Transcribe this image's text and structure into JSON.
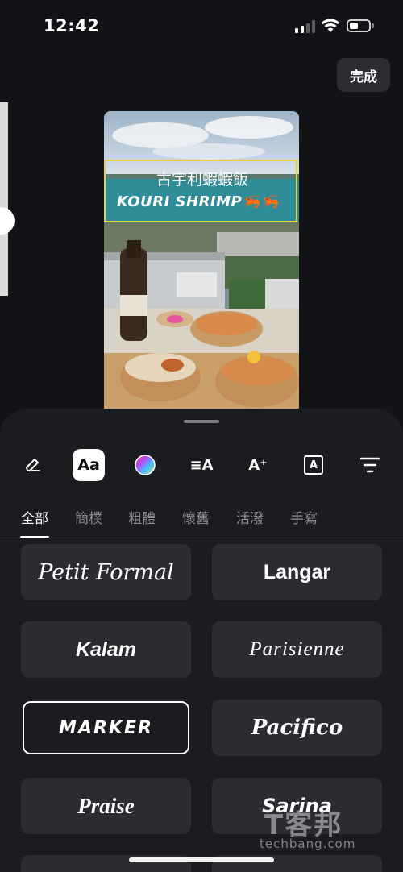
{
  "status_bar": {
    "time": "12:42"
  },
  "header": {
    "done_label": "完成"
  },
  "preview": {
    "overlay_title_cn": "古宇利蝦蝦飯",
    "overlay_title_en": "KOURI SHRIMP🦐🦐"
  },
  "toolbar": {
    "items": [
      {
        "icon": "pencil-erase-icon",
        "glyph": "✎"
      },
      {
        "icon": "font-style-icon",
        "glyph": "Aa",
        "active": true
      },
      {
        "icon": "color-wheel-icon"
      },
      {
        "icon": "text-align-icon",
        "glyph": "≡A"
      },
      {
        "icon": "text-effect-icon",
        "glyph": "A⁺"
      },
      {
        "icon": "text-background-icon",
        "glyph": "A"
      },
      {
        "icon": "filter-lines-icon",
        "glyph": "≡"
      }
    ]
  },
  "tabs": [
    {
      "label": "全部",
      "active": true
    },
    {
      "label": "簡樸"
    },
    {
      "label": "粗體"
    },
    {
      "label": "懷舊"
    },
    {
      "label": "活潑"
    },
    {
      "label": "手寫"
    }
  ],
  "fonts": [
    {
      "label": "Petit Formal"
    },
    {
      "label": "Langar"
    },
    {
      "label": "Kalam"
    },
    {
      "label": "Parisienne"
    },
    {
      "label": "Marker",
      "selected": true
    },
    {
      "label": "Pacifico"
    },
    {
      "label": "Praise"
    },
    {
      "label": "Sarina"
    }
  ],
  "watermark": {
    "cn": "T客邦",
    "en": "techbang.com"
  },
  "colors": {
    "background": "#121316",
    "sheet": "#1b1c20",
    "card": "#2b2c32",
    "overlay_border": "#e4d33a"
  }
}
